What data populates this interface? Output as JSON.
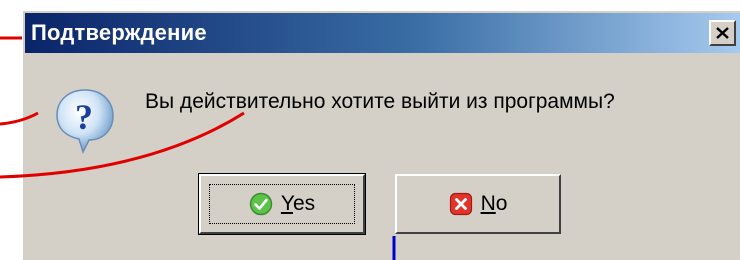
{
  "dialog": {
    "title": "Подтверждение",
    "message": "Вы действительно хотите выйти из программы?",
    "icon": "question-icon",
    "close_icon": "close-icon"
  },
  "buttons": {
    "yes": {
      "label": "Yes",
      "icon": "check-icon"
    },
    "no": {
      "label": "No",
      "icon": "x-icon"
    }
  },
  "colors": {
    "titlebar_start": "#0a246a",
    "titlebar_end": "#a6caf0",
    "dialog_bg": "#d4d0c8",
    "annotation_red": "#e00000",
    "annotation_blue": "#0000cc"
  }
}
